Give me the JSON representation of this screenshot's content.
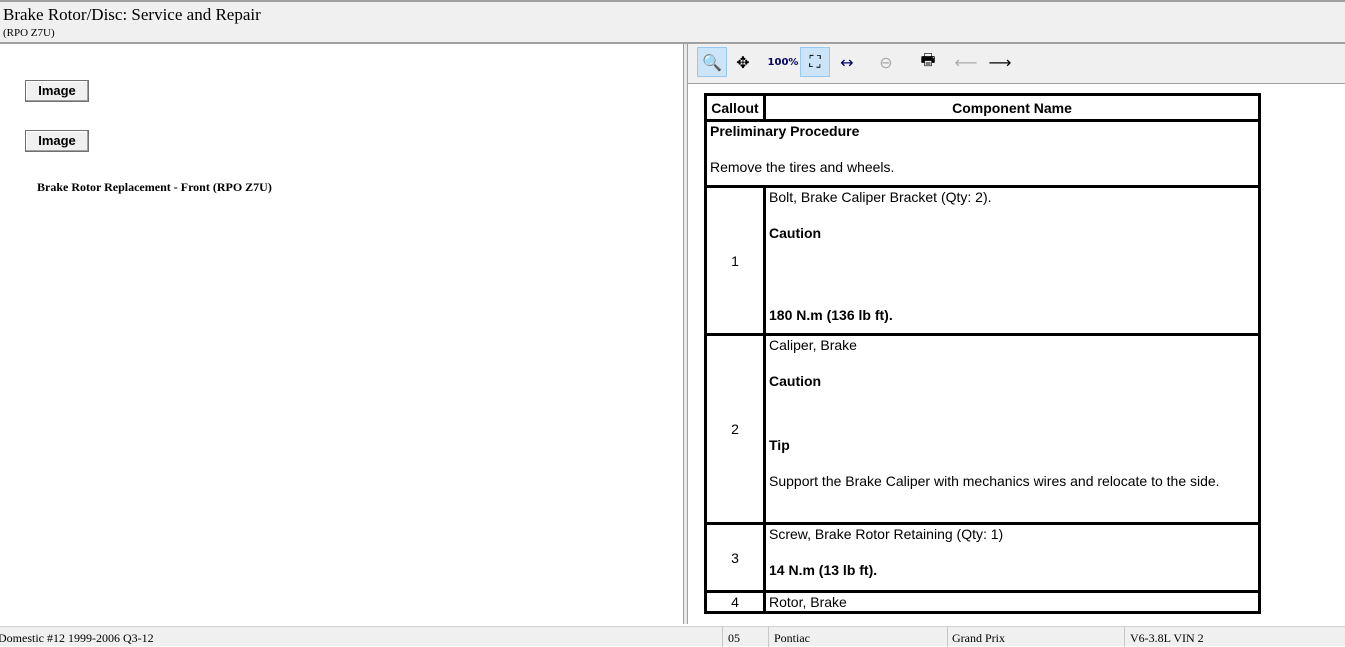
{
  "header": {
    "title": "Brake Rotor/Disc:  Service and Repair",
    "subtitle": "(RPO Z7U)"
  },
  "left": {
    "image_button_1": "Image",
    "image_button_2": "Image",
    "link": "Brake Rotor Replacement - Front (RPO Z7U)"
  },
  "toolbar": {
    "icons": [
      "zoom-in",
      "pan",
      "zoom-100",
      "zoom-fit",
      "zoom-width",
      "zoom-out",
      "print",
      "previous-image",
      "next-image"
    ]
  },
  "table": {
    "headers": [
      "Callout",
      "Component Name"
    ],
    "preliminary": {
      "title": "Preliminary Procedure",
      "text": "Remove the tires and wheels."
    },
    "rows": [
      {
        "callout": "1",
        "name": "Bolt, Brake Caliper Bracket (Qty: 2).",
        "caution": "Caution",
        "torque": "180 N.m (136 lb ft)."
      },
      {
        "callout": "2",
        "name": "Caliper, Brake",
        "caution": "Caution",
        "tip": "Tip",
        "tip_text": "Support the Brake Caliper with mechanics wires and relocate to the side."
      },
      {
        "callout": "3",
        "name": "Screw, Brake Rotor Retaining (Qty: 1)",
        "torque": "14 N.m (13 lb ft)."
      },
      {
        "callout": "4",
        "name": "Rotor, Brake"
      }
    ]
  },
  "status": {
    "db": "Domestic #12 1999-2006 Q3-12",
    "year": "05",
    "make": "Pontiac",
    "model": "Grand Prix",
    "engine": "V6-3.8L VIN 2"
  }
}
